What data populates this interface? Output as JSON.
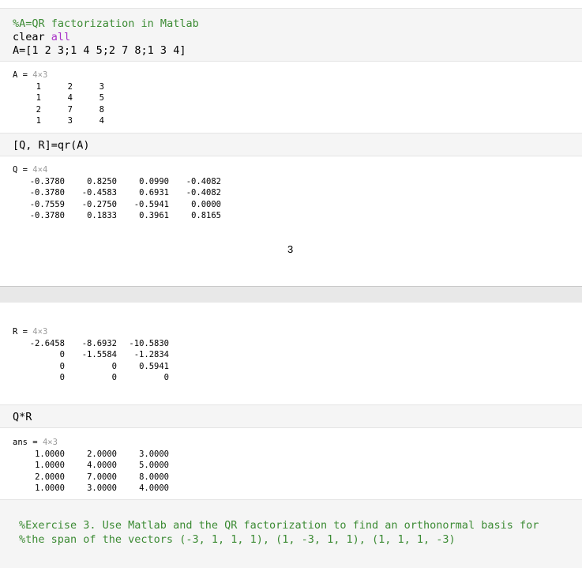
{
  "cells": {
    "init": {
      "lines": [
        "%A=QR factorization in Matlab",
        "clear",
        "all",
        "A=[1 2 3;1 4 5;2 7 8;1 3 4]"
      ]
    },
    "outA": {
      "var": "A =",
      "dims": "4×3",
      "rows": [
        [
          "1",
          "2",
          "3"
        ],
        [
          "1",
          "4",
          "5"
        ],
        [
          "2",
          "7",
          "8"
        ],
        [
          "1",
          "3",
          "4"
        ]
      ]
    },
    "qr": {
      "code": "[Q, R]=qr(A)"
    },
    "outQ": {
      "var": "Q =",
      "dims": "4×4",
      "rows": [
        [
          "-0.3780",
          "0.8250",
          "0.0990",
          "-0.4082"
        ],
        [
          "-0.3780",
          "-0.4583",
          "0.6931",
          "-0.4082"
        ],
        [
          "-0.7559",
          "-0.2750",
          "-0.5941",
          "0.0000"
        ],
        [
          "-0.3780",
          "0.1833",
          "0.3961",
          "0.8165"
        ]
      ]
    },
    "page_number": "3",
    "outR": {
      "var": "R =",
      "dims": "4×3",
      "rows": [
        [
          "-2.6458",
          "-8.6932",
          "-10.5830"
        ],
        [
          "0",
          "-1.5584",
          "-1.2834"
        ],
        [
          "0",
          "0",
          "0.5941"
        ],
        [
          "0",
          "0",
          "0"
        ]
      ]
    },
    "qtimesr": {
      "code": "Q*R"
    },
    "outAns": {
      "var": "ans =",
      "dims": "4×3",
      "rows": [
        [
          "1.0000",
          "2.0000",
          "3.0000"
        ],
        [
          "1.0000",
          "4.0000",
          "5.0000"
        ],
        [
          "2.0000",
          "7.0000",
          "8.0000"
        ],
        [
          "1.0000",
          "3.0000",
          "4.0000"
        ]
      ]
    },
    "exercise": {
      "lines": [
        "%Exercise 3. Use Matlab and the QR factorization to find an orthonormal basis for",
        "%the span of the vectors (-3, 1, 1, 1), (1, -3, 1, 1), (1, 1, 1, -3)"
      ]
    }
  },
  "colors": {
    "comment": "#3c8b34",
    "keyword": "#a932c8",
    "cell_bg": "#f5f5f5"
  }
}
